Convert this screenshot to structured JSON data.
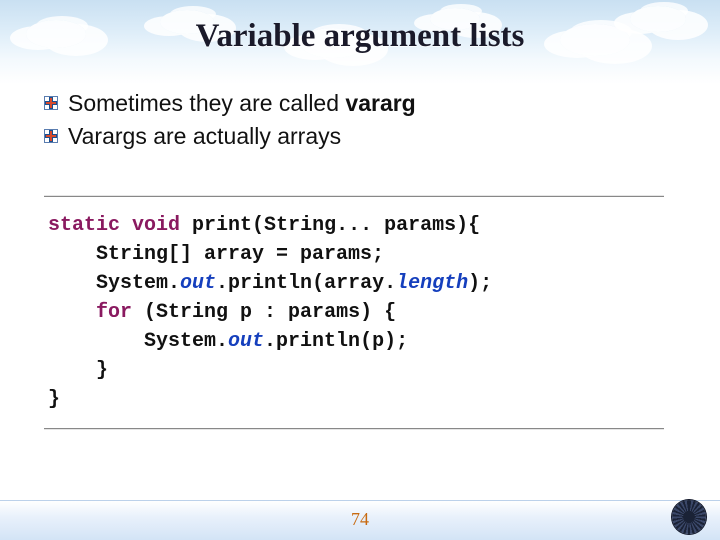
{
  "title": "Variable argument lists",
  "bullets": [
    {
      "pre": "Sometimes they are called ",
      "bold": "vararg",
      "post": ""
    },
    {
      "pre": "Varargs are actually arrays",
      "bold": "",
      "post": ""
    }
  ],
  "code": {
    "l1_kw1": "static",
    "l1_kw2": "void",
    "l1_rest": " print(String... params){",
    "l2": "    String[] array = params;",
    "l3_a": "    System.",
    "l3_out": "out",
    "l3_b": ".println(array.",
    "l3_len": "length",
    "l3_c": ");",
    "l4_kw": "for",
    "l4_rest": " (String p : params) {",
    "l5_a": "        System.",
    "l5_out": "out",
    "l5_b": ".println(p);",
    "l6": "    }",
    "l7": "}"
  },
  "page": "74"
}
